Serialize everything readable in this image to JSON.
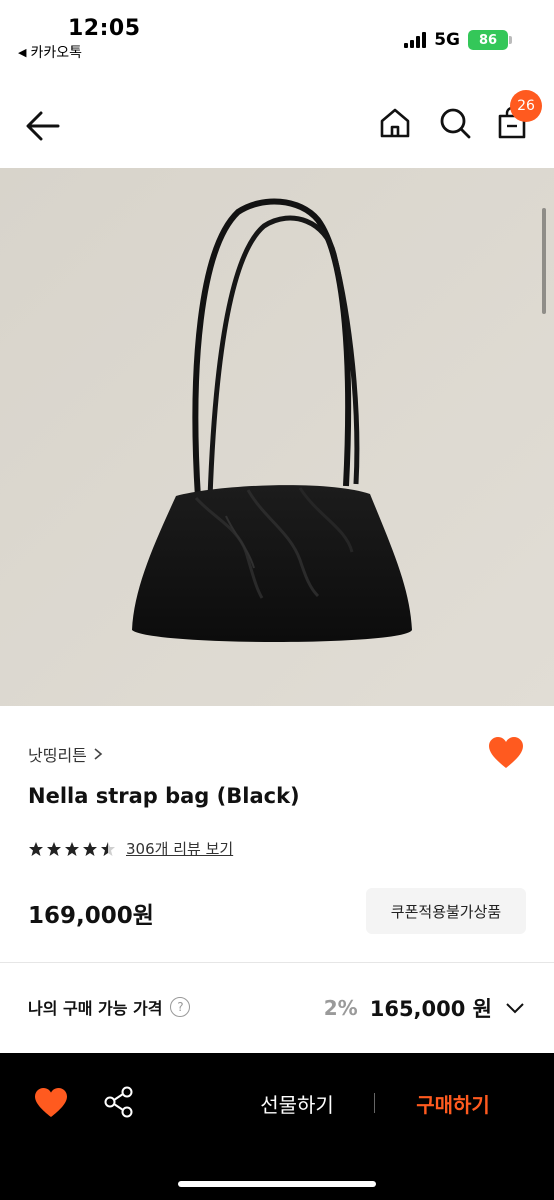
{
  "status_bar": {
    "time": "12:05",
    "back_app": "카카오톡",
    "network": "5G",
    "battery": "86"
  },
  "nav": {
    "cart_count": "26"
  },
  "product": {
    "brand": "낫띵리튼",
    "name": "Nella strap bag (Black)",
    "rating": 4.5,
    "review_link": "306개 리뷰 보기",
    "price": "169,000원",
    "coupon_badge": "쿠폰적용불가상품"
  },
  "my_price": {
    "label": "나의 구매 가능 가격",
    "discount_rate": "2%",
    "discount_price": "165,000 원"
  },
  "bottom_bar": {
    "gift_label": "선물하기",
    "buy_label": "구매하기"
  },
  "colors": {
    "accent": "#ff5a1f",
    "image_background": "#dcd8cf",
    "bottom_bar": "#000000"
  }
}
